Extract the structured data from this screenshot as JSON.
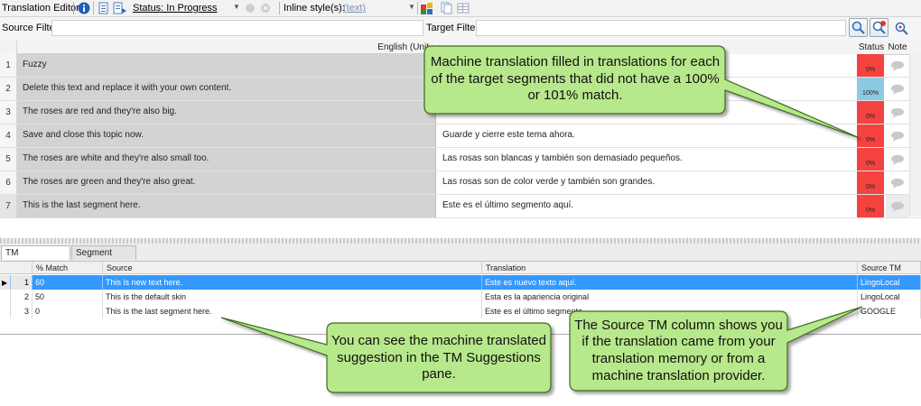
{
  "toolbar": {
    "title": "Translation Editor",
    "status_label": "Status: In Progress",
    "inline_styles_label": "Inline style(s):",
    "inline_styles_value": "(text)"
  },
  "filters": {
    "source_label": "Source Filter:",
    "target_label": "Target Filter:"
  },
  "grid": {
    "source_header": "English (Unit",
    "status_header": "Status",
    "note_header": "Note",
    "rows": [
      {
        "num": "1",
        "source": "Fuzzy",
        "target": "",
        "status": "0%",
        "status_color": "#f4423f"
      },
      {
        "num": "2",
        "source": "Delete this text and replace it with your own content.",
        "target": "",
        "status": "100%",
        "status_color": "#8ec9e4"
      },
      {
        "num": "3",
        "source": "The roses are red and they're also big.",
        "target": "",
        "status": "0%",
        "status_color": "#f4423f"
      },
      {
        "num": "4",
        "source": "Save and close this topic now.",
        "target": "Guarde y cierre este tema ahora.",
        "status": "0%",
        "status_color": "#f4423f"
      },
      {
        "num": "5",
        "source": "The roses are white and they're also small too.",
        "target": "Las rosas son blancas y también son demasiado pequeños.",
        "status": "0%",
        "status_color": "#f4423f"
      },
      {
        "num": "6",
        "source": "The roses are green and they're also great.",
        "target": "Las rosas son de color verde y también son grandes.",
        "status": "0%",
        "status_color": "#f4423f"
      },
      {
        "num": "7",
        "source": "This is the last segment here.",
        "target": "Este es el último segmento aquí.",
        "status": "0%",
        "status_color": "#f4423f"
      }
    ]
  },
  "tabs": {
    "tm_suggestions": "TM Suggestions",
    "segment_notes": "Segment Notes"
  },
  "tm_table": {
    "headers": {
      "match": "% Match",
      "source": "Source",
      "translation": "Translation",
      "source_tm": "Source TM"
    },
    "rows": [
      {
        "num": "1",
        "match": "60",
        "source": "This is new text here.",
        "translation": "Este es nuevo texto aquí.",
        "source_tm": "LingoLocal"
      },
      {
        "num": "2",
        "match": "50",
        "source": "This is the default skin",
        "translation": "Esta es la apariencia original",
        "source_tm": "LingoLocal"
      },
      {
        "num": "3",
        "match": "0",
        "source": "This is the last segment here.",
        "translation": "Este es el último segmento",
        "source_tm": "GOOGLE"
      }
    ]
  },
  "callouts": {
    "machine_translation": "Machine translation filled in translations for each of the target segments that did not have a 100% or 101% match.",
    "tm_suggestions": "You can see the machine translated suggestion in the TM Suggestions pane.",
    "source_tm": "The Source TM column shows you if the translation came from your translation memory or from a machine translation provider."
  },
  "colors": {
    "status_red": "#f4423f",
    "status_blue": "#8ec9e4",
    "selection_blue": "#3399ff",
    "callout_fill": "#b7e88b",
    "callout_border": "#3d6b1f"
  }
}
